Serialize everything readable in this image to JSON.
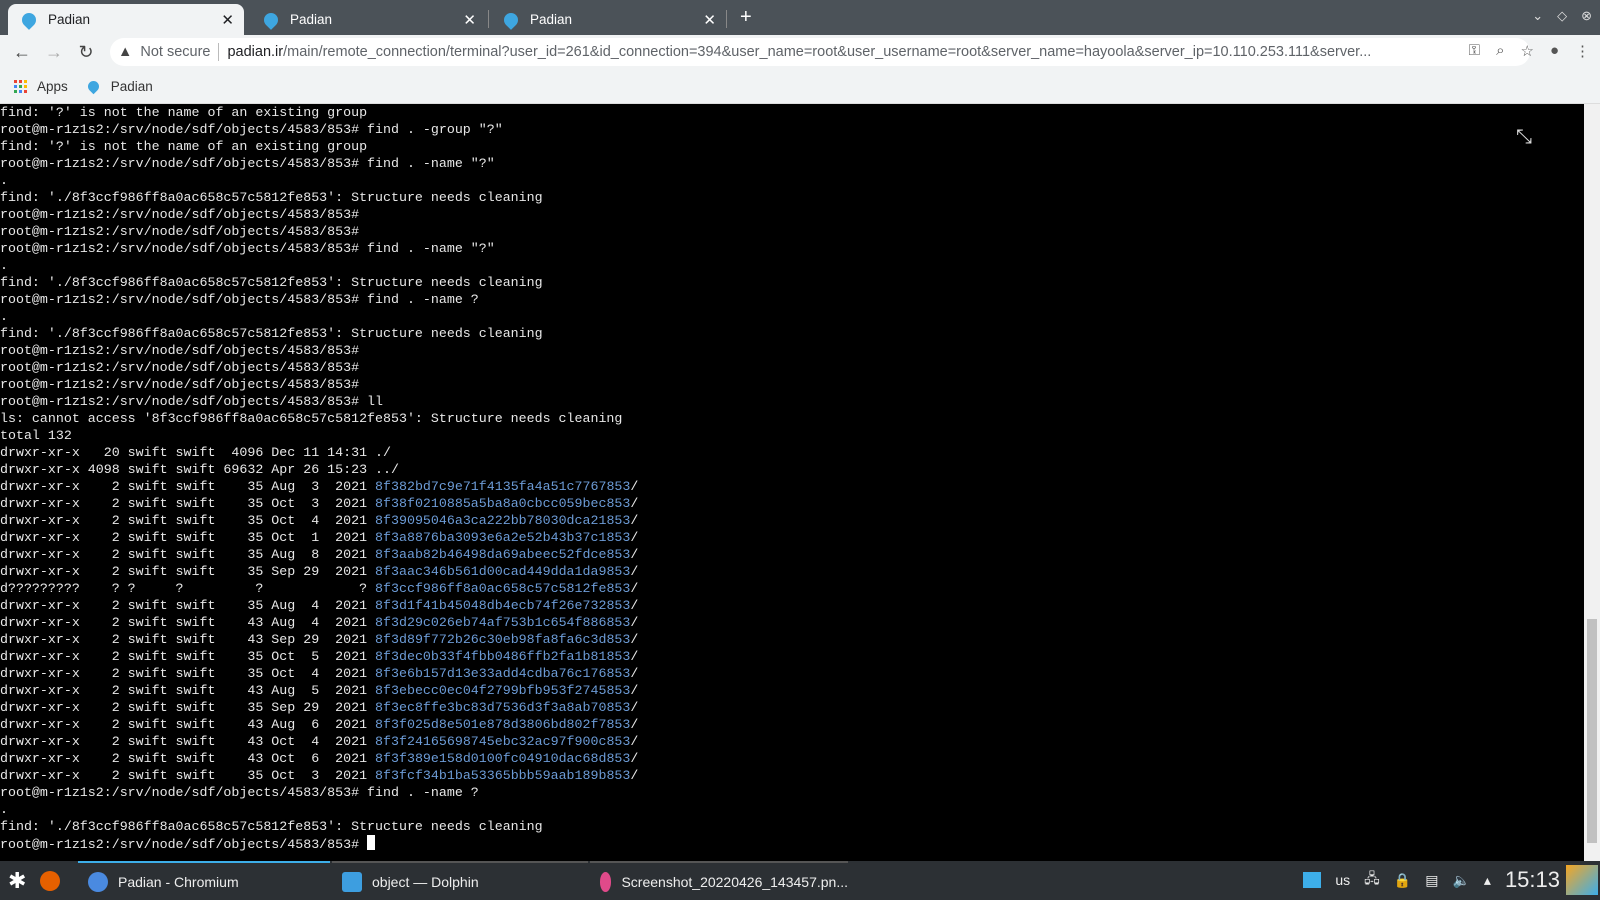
{
  "browser": {
    "tabs": [
      {
        "label": "Padian"
      },
      {
        "label": "Padian"
      },
      {
        "label": "Padian"
      }
    ],
    "not_secure": "Not secure",
    "url_host": "padian.ir",
    "url_path": "/main/remote_connection/terminal?user_id=261&id_connection=394&user_name=root&user_username=root&server_name=hayoola&server_ip=10.110.253.111&server...",
    "bookmarks": [
      {
        "label": "Apps"
      },
      {
        "label": "Padian"
      }
    ]
  },
  "terminal": {
    "prompt": "root@m-r1z1s2:/srv/node/sdf/objects/4583/853#",
    "lines": [
      "find: '?' is not the name of an existing group",
      "root@m-r1z1s2:/srv/node/sdf/objects/4583/853# find . -group \"?\"",
      "find: '?' is not the name of an existing group",
      "root@m-r1z1s2:/srv/node/sdf/objects/4583/853# find . -name \"?\"",
      ".",
      "find: './8f3ccf986ff8a0ac658c57c5812fe853': Structure needs cleaning",
      "root@m-r1z1s2:/srv/node/sdf/objects/4583/853#",
      "root@m-r1z1s2:/srv/node/sdf/objects/4583/853#",
      "root@m-r1z1s2:/srv/node/sdf/objects/4583/853# find . -name \"?\"",
      ".",
      "find: './8f3ccf986ff8a0ac658c57c5812fe853': Structure needs cleaning",
      "root@m-r1z1s2:/srv/node/sdf/objects/4583/853# find . -name ?",
      ".",
      "find: './8f3ccf986ff8a0ac658c57c5812fe853': Structure needs cleaning",
      "root@m-r1z1s2:/srv/node/sdf/objects/4583/853#",
      "root@m-r1z1s2:/srv/node/sdf/objects/4583/853#",
      "root@m-r1z1s2:/srv/node/sdf/objects/4583/853#",
      "root@m-r1z1s2:/srv/node/sdf/objects/4583/853# ll",
      "ls: cannot access '8f3ccf986ff8a0ac658c57c5812fe853': Structure needs cleaning",
      "total 132"
    ],
    "listing": [
      {
        "meta": "drwxr-xr-x   20 swift swift  4096 Dec 11 14:31 ",
        "name": "./",
        "dir": false
      },
      {
        "meta": "drwxr-xr-x 4098 swift swift 69632 Apr 26 15:23 ",
        "name": "../",
        "dir": false
      },
      {
        "meta": "drwxr-xr-x    2 swift swift    35 Aug  3  2021 ",
        "name": "8f382bd7c9e71f4135fa4a51c7767853",
        "dir": true
      },
      {
        "meta": "drwxr-xr-x    2 swift swift    35 Oct  3  2021 ",
        "name": "8f38f0210885a5ba8a0cbcc059bec853",
        "dir": true
      },
      {
        "meta": "drwxr-xr-x    2 swift swift    35 Oct  4  2021 ",
        "name": "8f39095046a3ca222bb78030dca21853",
        "dir": true
      },
      {
        "meta": "drwxr-xr-x    2 swift swift    35 Oct  1  2021 ",
        "name": "8f3a8876ba3093e6a2e52b43b37c1853",
        "dir": true
      },
      {
        "meta": "drwxr-xr-x    2 swift swift    35 Aug  8  2021 ",
        "name": "8f3aab82b46498da69abeec52fdce853",
        "dir": true
      },
      {
        "meta": "drwxr-xr-x    2 swift swift    35 Sep 29  2021 ",
        "name": "8f3aac346b561d00cad449dda1da9853",
        "dir": true
      },
      {
        "meta": "d?????????    ? ?     ?         ?            ? ",
        "name": "8f3ccf986ff8a0ac658c57c5812fe853",
        "dir": true
      },
      {
        "meta": "drwxr-xr-x    2 swift swift    35 Aug  4  2021 ",
        "name": "8f3d1f41b45048db4ecb74f26e732853",
        "dir": true
      },
      {
        "meta": "drwxr-xr-x    2 swift swift    43 Aug  4  2021 ",
        "name": "8f3d29c026eb74af753b1c654f886853",
        "dir": true
      },
      {
        "meta": "drwxr-xr-x    2 swift swift    43 Sep 29  2021 ",
        "name": "8f3d89f772b26c30eb98fa8fa6c3d853",
        "dir": true
      },
      {
        "meta": "drwxr-xr-x    2 swift swift    35 Oct  5  2021 ",
        "name": "8f3dec0b33f4fbb0486ffb2fa1b81853",
        "dir": true
      },
      {
        "meta": "drwxr-xr-x    2 swift swift    35 Oct  4  2021 ",
        "name": "8f3e6b157d13e33add4cdba76c176853",
        "dir": true
      },
      {
        "meta": "drwxr-xr-x    2 swift swift    43 Aug  5  2021 ",
        "name": "8f3ebecc0ec04f2799bfb953f2745853",
        "dir": true
      },
      {
        "meta": "drwxr-xr-x    2 swift swift    35 Sep 29  2021 ",
        "name": "8f3ec8ffe3bc83d7536d3f3a8ab70853",
        "dir": true
      },
      {
        "meta": "drwxr-xr-x    2 swift swift    43 Aug  6  2021 ",
        "name": "8f3f025d8e501e878d3806bd802f7853",
        "dir": true
      },
      {
        "meta": "drwxr-xr-x    2 swift swift    43 Oct  4  2021 ",
        "name": "8f3f24165698745ebc32ac97f900c853",
        "dir": true
      },
      {
        "meta": "drwxr-xr-x    2 swift swift    43 Oct  6  2021 ",
        "name": "8f3f389e158d0100fc04910dac68d853",
        "dir": true
      },
      {
        "meta": "drwxr-xr-x    2 swift swift    35 Oct  3  2021 ",
        "name": "8f3fcf34b1ba53365bbb59aab189b853",
        "dir": true
      }
    ],
    "tail": [
      "root@m-r1z1s2:/srv/node/sdf/objects/4583/853# find . -name ?",
      ".",
      "find: './8f3ccf986ff8a0ac658c57c5812fe853': Structure needs cleaning"
    ],
    "dir_color": "#6c9bd6"
  },
  "taskbar": {
    "tasks": [
      {
        "label": "Padian - Chromium"
      },
      {
        "label": "object — Dolphin"
      },
      {
        "label": "Screenshot_20220426_143457.pn..."
      }
    ],
    "keyboard_layout": "us",
    "clock": "15:13"
  }
}
